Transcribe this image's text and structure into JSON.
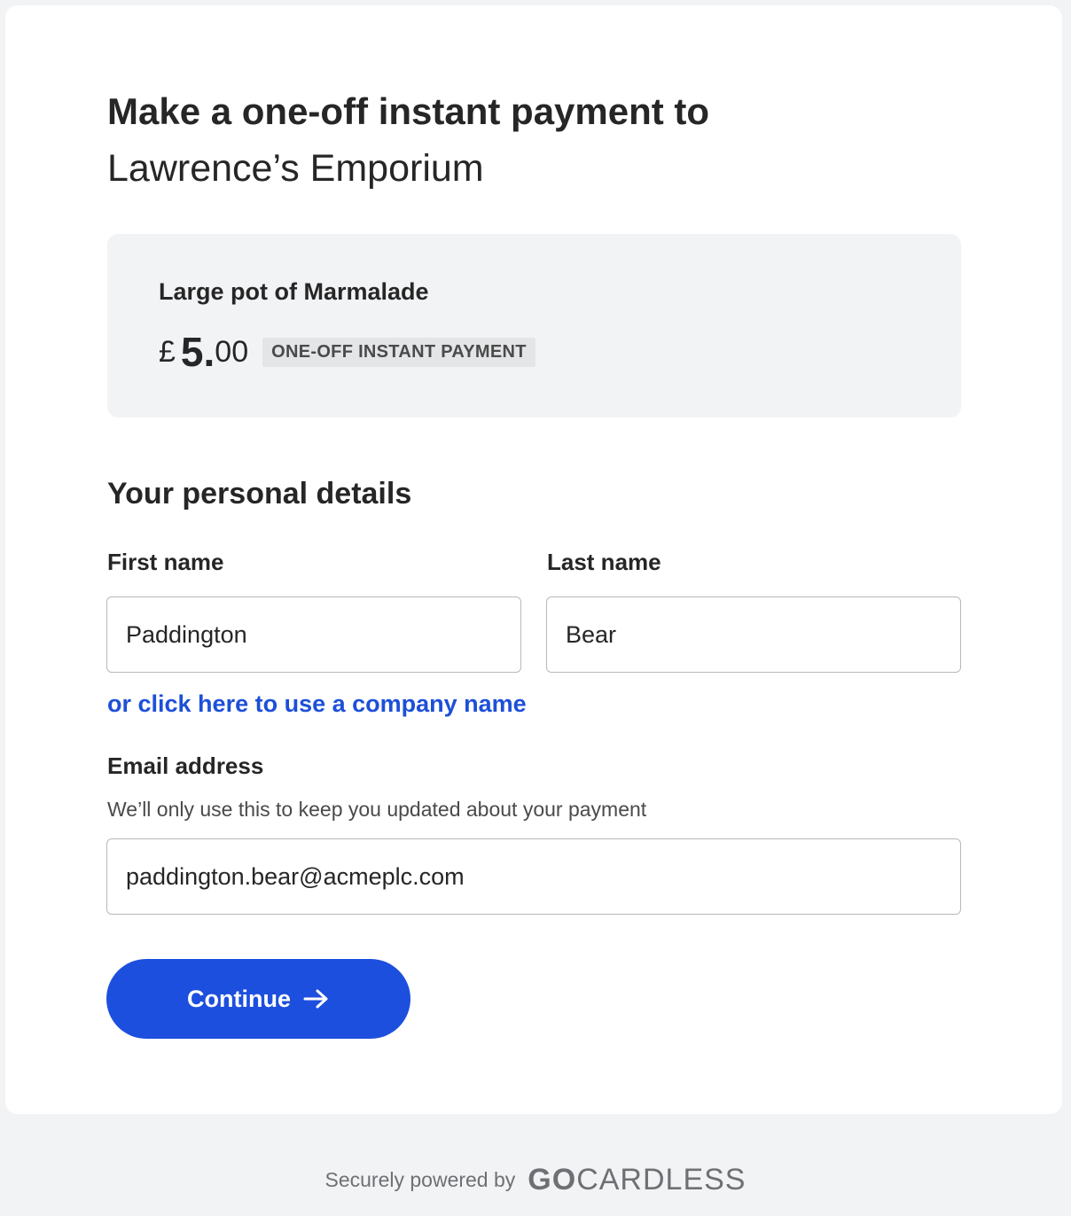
{
  "header": {
    "title_line1": "Make a one-off instant payment to",
    "title_line2": "Lawrence’s Emporium"
  },
  "summary": {
    "item": "Large pot of Marmalade",
    "currency_symbol": "£",
    "amount_major": "5",
    "amount_minor": "00",
    "badge": "ONE-OFF INSTANT PAYMENT"
  },
  "personal_details": {
    "section_title": "Your personal details",
    "first_name": {
      "label": "First name",
      "value": "Paddington"
    },
    "last_name": {
      "label": "Last name",
      "value": "Bear"
    },
    "company_link": "or click here to use a company name",
    "email": {
      "label": "Email address",
      "hint": "We’ll only use this to keep you updated about your payment",
      "value": "paddington.bear@acmeplc.com"
    }
  },
  "actions": {
    "continue_label": "Continue"
  },
  "footer": {
    "text": "Securely powered by",
    "logo_bold": "GO",
    "logo_rest": "CARDLESS"
  },
  "colors": {
    "primary": "#1d4fde",
    "link": "#1d4fd8",
    "page_background": "#f2f3f5",
    "card_background": "#ffffff",
    "text": "#262626"
  },
  "icons": {
    "continue_icon": "arrow-right-icon"
  }
}
